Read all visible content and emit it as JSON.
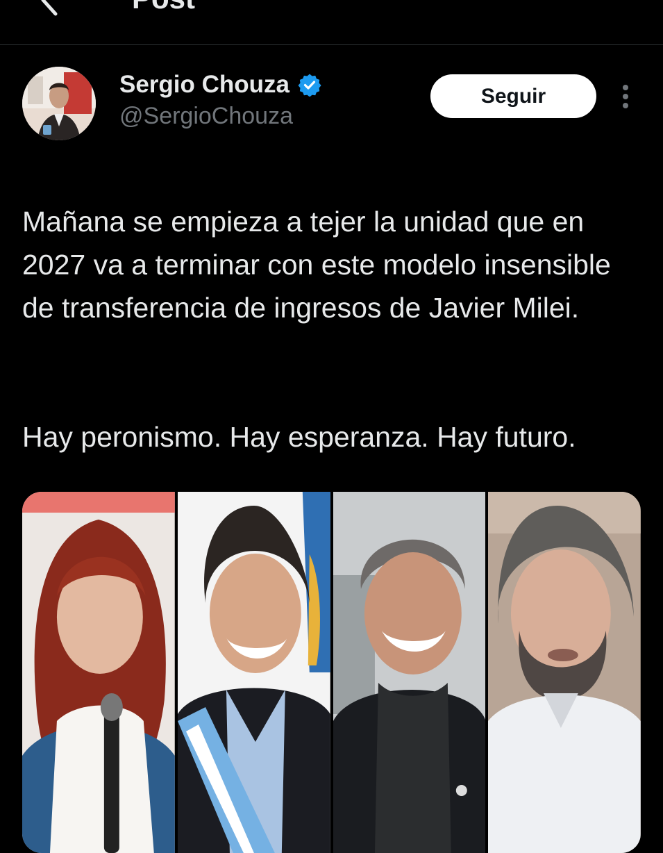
{
  "header": {
    "title": "Post",
    "back_icon": "arrow-left-icon"
  },
  "author": {
    "display_name": "Sergio Chouza",
    "handle": "@SergioChouza",
    "verified_icon": "verified-badge-icon",
    "verified_color": "#1d9bf0"
  },
  "actions": {
    "follow_label": "Seguir",
    "more_icon": "more-vertical-icon"
  },
  "post": {
    "paragraph_1": "Mañana se empieza a tejer la unidad que en 2027 va a terminar con este modelo insensible de transferencia de ingresos de Javier Milei.",
    "paragraph_2": "Hay peronismo. Hay esperanza. Hay futuro."
  },
  "media": {
    "photos": [
      "woman-red-hair-portrait",
      "man-sash-portrait",
      "man-smiling-portrait",
      "man-gray-hair-portrait"
    ]
  },
  "colors": {
    "background": "#000000",
    "text": "#e7e9ea",
    "secondary_text": "#71767b",
    "accent": "#1d9bf0"
  }
}
